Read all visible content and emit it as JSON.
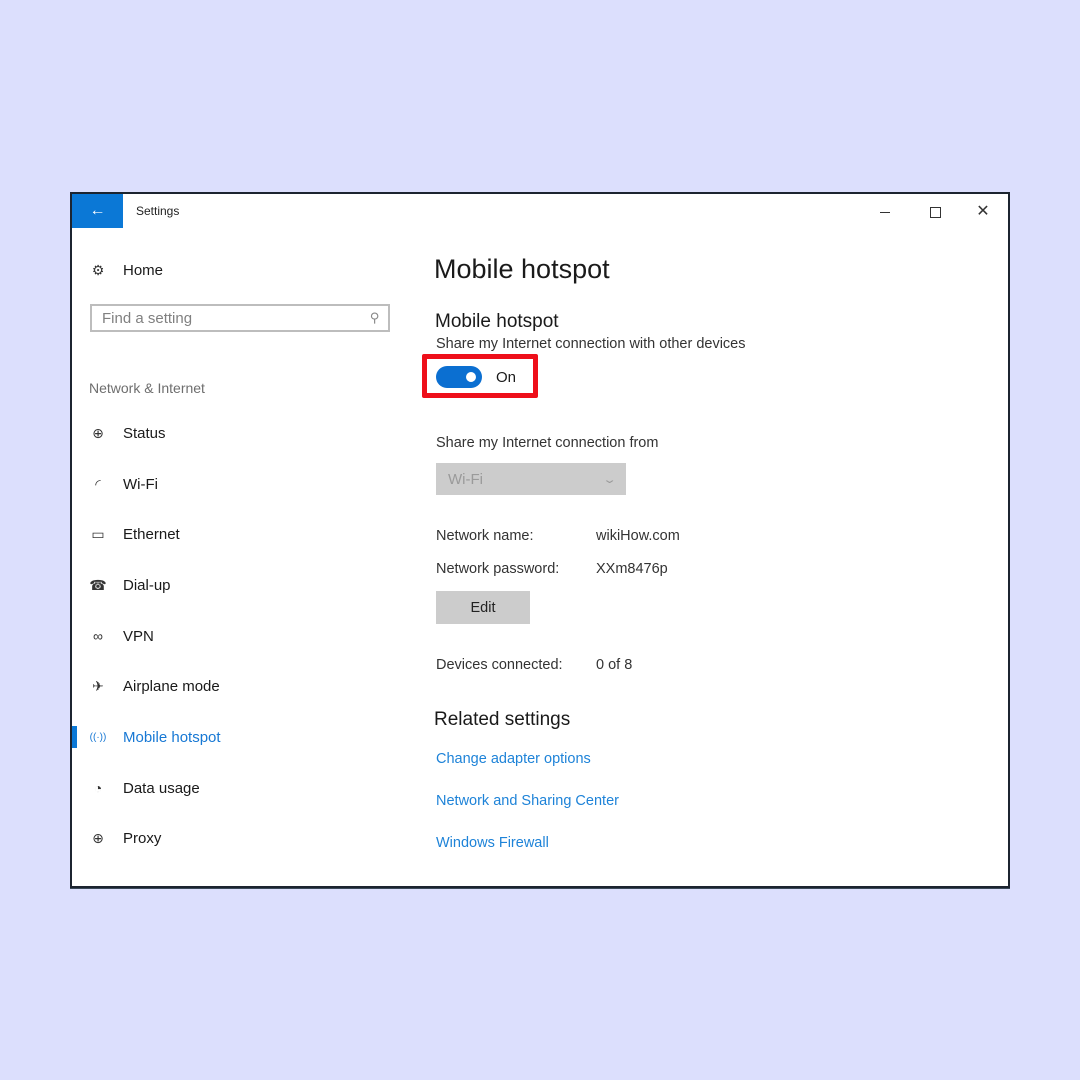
{
  "window": {
    "title": "Settings",
    "back_icon": "←",
    "controls": {
      "minimize": "minimize",
      "maximize": "maximize",
      "close": "✕"
    }
  },
  "sidebar": {
    "home": {
      "icon": "gear-icon",
      "glyph": "⚙",
      "label": "Home"
    },
    "search": {
      "placeholder": "Find a setting",
      "value": "",
      "icon_glyph": "⚲"
    },
    "section_label": "Network & Internet",
    "items": [
      {
        "label": "Status",
        "icon": "globe-status-icon",
        "glyph": "⊕",
        "active": false
      },
      {
        "label": "Wi-Fi",
        "icon": "wifi-icon",
        "glyph": "◜",
        "active": false
      },
      {
        "label": "Ethernet",
        "icon": "ethernet-icon",
        "glyph": "▭",
        "active": false
      },
      {
        "label": "Dial-up",
        "icon": "dialup-phone-icon",
        "glyph": "☎",
        "active": false
      },
      {
        "label": "VPN",
        "icon": "vpn-icon",
        "glyph": "∞",
        "active": false
      },
      {
        "label": "Airplane mode",
        "icon": "airplane-icon",
        "glyph": "✈",
        "active": false
      },
      {
        "label": "Mobile hotspot",
        "icon": "hotspot-icon",
        "glyph": "((·))",
        "active": true
      },
      {
        "label": "Data usage",
        "icon": "data-usage-icon",
        "glyph": "◔",
        "active": false
      },
      {
        "label": "Proxy",
        "icon": "proxy-globe-icon",
        "glyph": "⊕",
        "active": false
      }
    ]
  },
  "main": {
    "page_title": "Mobile hotspot",
    "section_title": "Mobile hotspot",
    "section_desc": "Share my Internet connection with other devices",
    "toggle": {
      "state": "On",
      "on": true
    },
    "share_from": {
      "label": "Share my Internet connection from",
      "selected": "Wi-Fi",
      "disabled": true
    },
    "network_name": {
      "label": "Network name:",
      "value": "wikiHow.com"
    },
    "network_password": {
      "label": "Network password:",
      "value": "XXm8476p"
    },
    "edit_label": "Edit",
    "devices_connected": {
      "label": "Devices connected:",
      "value": "0 of 8"
    },
    "related": {
      "title": "Related settings",
      "links": [
        "Change adapter options",
        "Network and Sharing Center",
        "Windows Firewall"
      ]
    }
  },
  "colors": {
    "accent": "#0b78d6",
    "link": "#1e83d8",
    "highlight": "#ee0f1a",
    "background": "#dcdffd"
  }
}
